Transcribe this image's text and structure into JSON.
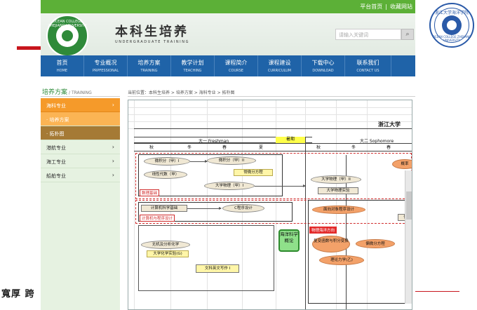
{
  "slide": {
    "calligraphy": "寬厚 跨",
    "right_logo_top": "浙江大学海洋学院",
    "right_logo_bottom": "OCEAN COLLEGE ZHEJIANG UNIVERSITY",
    "accent_color": "#c8161d"
  },
  "topbar": {
    "home": "平台首页",
    "separator": "|",
    "favorite": "收藏网站"
  },
  "header": {
    "logo_text": "OCEAN COLLEGE ZHEJIANG UNIVERSITY",
    "title": "本科生培养",
    "subtitle": "UNDERGRADUATE TRAINING",
    "search_placeholder": "请输入关键词",
    "search_icon": "search-icon"
  },
  "nav": [
    {
      "cn": "首页",
      "en": "HOME"
    },
    {
      "cn": "专业概况",
      "en": "PRPFESSIONAL"
    },
    {
      "cn": "培养方案",
      "en": "TRAINING"
    },
    {
      "cn": "教学计划",
      "en": "TEACHING"
    },
    {
      "cn": "课程简介",
      "en": "COURSE"
    },
    {
      "cn": "课程建设",
      "en": "CURRICULUM"
    },
    {
      "cn": "下载中心",
      "en": "DOWNLOAD"
    },
    {
      "cn": "联系我们",
      "en": "CONTACT US"
    }
  ],
  "sidebar": {
    "title": "培养方案",
    "title_en": "/ TRAINING",
    "items": [
      {
        "label": "海科专业",
        "chevron": "›"
      },
      {
        "label": "· 培养方案"
      },
      {
        "label": "· 拓朴图"
      },
      {
        "label": "港航专业",
        "chevron": "›"
      },
      {
        "label": "海工专业",
        "chevron": "›"
      },
      {
        "label": "船舶专业",
        "chevron": "›"
      }
    ]
  },
  "breadcrumb": "当前位置：本科生培养 > 培养方案 > 海科专业 > 拓朴图",
  "flowchart": {
    "school": "浙江大学",
    "year1": "大一 Freshman",
    "summer": "暑期",
    "year2": "大二 Sophomore",
    "seasons": [
      "秋",
      "冬",
      "春",
      "夏",
      "秋",
      "冬",
      "春"
    ],
    "courses": {
      "calc1": "微积分（甲）I",
      "calc2": "微积分（甲）II",
      "ode": "常微分方程",
      "linalg": "线性代数（甲）",
      "phys1": "大学物理（甲）I",
      "phys2": "大学物理（甲）II",
      "physlab": "大学物理实验",
      "prob": "概率",
      "cs_basic": "计算机科学基础",
      "cprog": "C程序设计",
      "oop": "面向对象程序设计",
      "ocean": "海洋科学概论",
      "chem": "无机及分析化学",
      "chemlab": "大学化学实验(G)",
      "english": "文科英文写作 I",
      "complex": "复变函数与积分变换",
      "pde": "偏微分方程",
      "theomech": "理论力学(乙)",
      "info": "信"
    },
    "tags": {
      "math_base": "数理基础",
      "cs_prog": "计算机与程序设计",
      "physocean": "物理海洋方向"
    }
  }
}
